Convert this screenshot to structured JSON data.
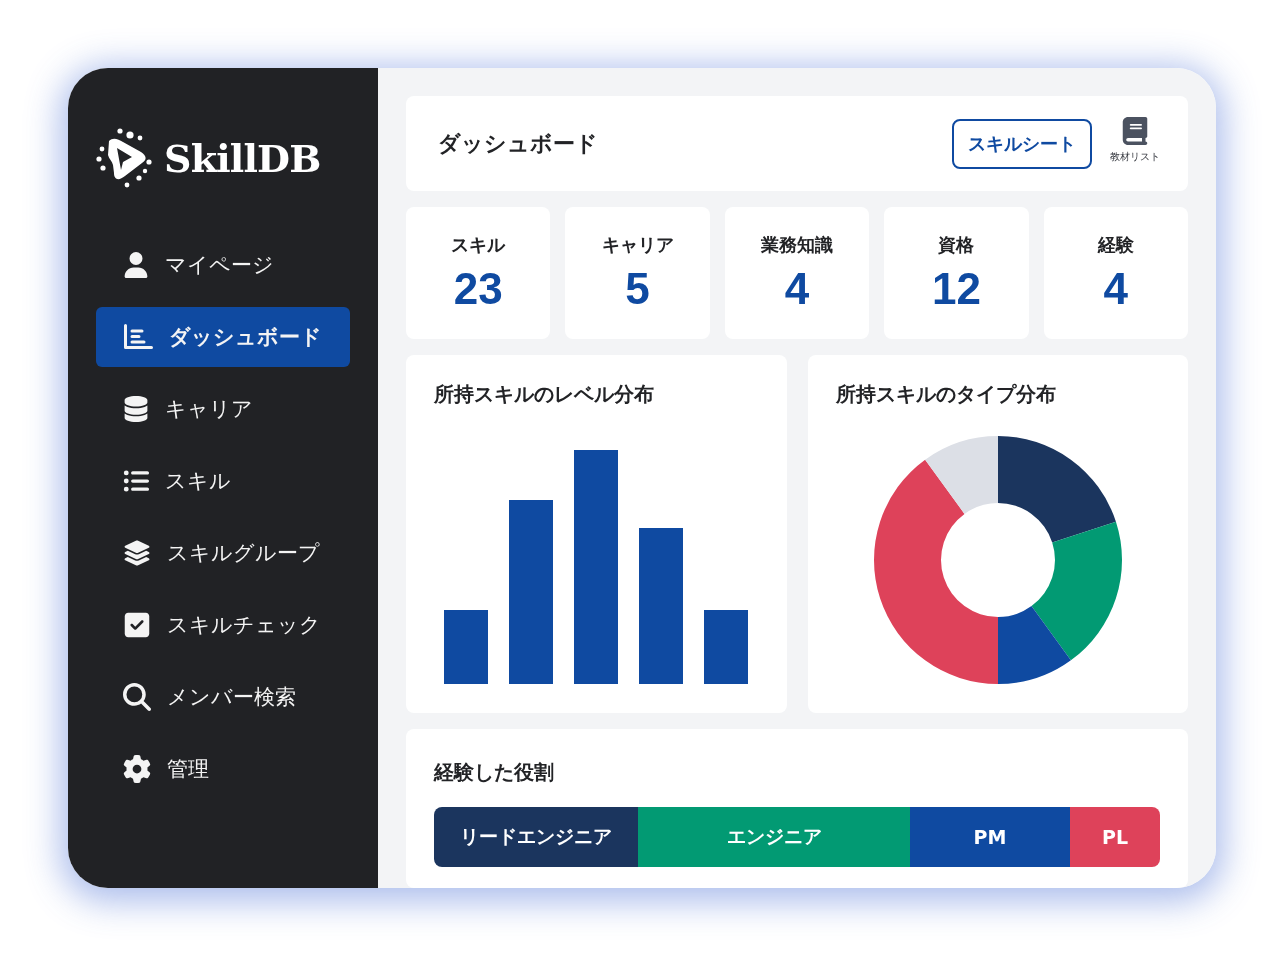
{
  "sidebar": {
    "logo": "SkillDB",
    "items": [
      {
        "label": "マイページ",
        "selected": false
      },
      {
        "label": "ダッシュボード",
        "selected": true
      },
      {
        "label": "キャリア",
        "selected": false
      },
      {
        "label": "スキル",
        "selected": false
      },
      {
        "label": "スキルグループ",
        "selected": false
      },
      {
        "label": "スキルチェック",
        "selected": false
      },
      {
        "label": "メンバー検索",
        "selected": false
      },
      {
        "label": "管理",
        "selected": false
      }
    ]
  },
  "header": {
    "title": "ダッシュボード",
    "skill_sheet_button": "スキルシート",
    "materials_button": "教材リスト"
  },
  "stats": [
    {
      "label": "スキル",
      "value": "23"
    },
    {
      "label": "キャリア",
      "value": "5"
    },
    {
      "label": "業務知識",
      "value": "4"
    },
    {
      "label": "資格",
      "value": "12"
    },
    {
      "label": "経験",
      "value": "4"
    }
  ],
  "level_chart": {
    "title": "所持スキルのレベル分布"
  },
  "type_chart": {
    "title": "所持スキルのタイプ分布"
  },
  "roles": {
    "title": "経験した役割",
    "segments": [
      {
        "label": "リードエンジニア",
        "color": "#1b355e"
      },
      {
        "label": "エンジニア",
        "color": "#029a73"
      },
      {
        "label": "PM",
        "color": "#0f4aa1"
      },
      {
        "label": "PL",
        "color": "#de425a"
      }
    ]
  }
}
